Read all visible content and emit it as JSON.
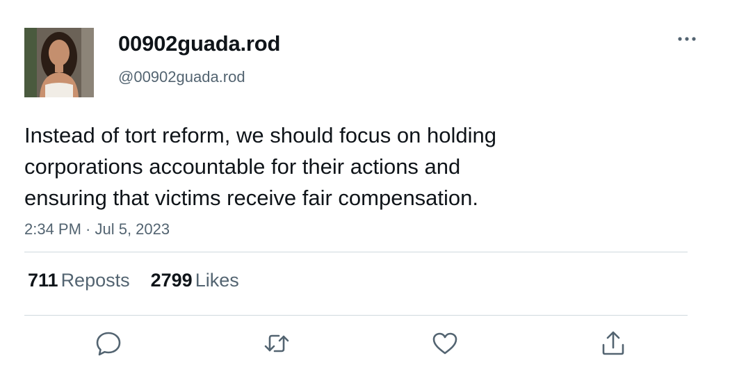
{
  "user": {
    "display_name": "00902guada.rod",
    "handle": "@00902guada.rod"
  },
  "tweet": {
    "lines": [
      "Instead of tort reform, we should focus on holding",
      "corporations accountable for their actions and",
      "ensuring that victims receive fair compensation."
    ],
    "timestamp": "2:34 PM · Jul 5, 2023"
  },
  "stats": {
    "reposts_count": "711",
    "reposts_label": "Reposts",
    "likes_count": "2799",
    "likes_label": "Likes"
  },
  "icons": {
    "more": "more-horizontal-icon",
    "reply": "reply-icon",
    "repost": "repost-icon",
    "like": "heart-icon",
    "share": "share-icon"
  },
  "colors": {
    "text_primary": "#0f1419",
    "text_secondary": "#536471",
    "divider": "#cfd9de"
  }
}
